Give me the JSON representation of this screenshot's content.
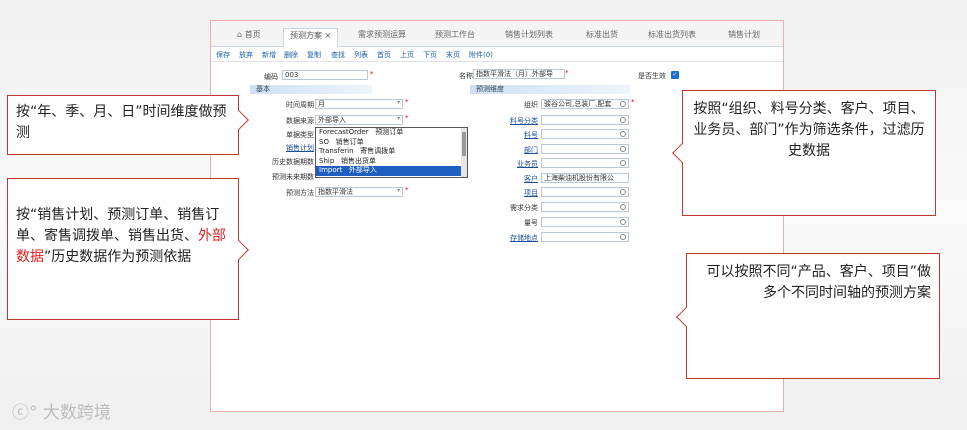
{
  "tabs": [
    "首页",
    "预测方案",
    "需求预测运算",
    "预测工作台",
    "销售计划列表",
    "标准出货",
    "标准出货列表",
    "销售计划"
  ],
  "toolbar": [
    "保存",
    "放弃",
    "新增",
    "删除",
    "复制",
    "查找",
    "列表",
    "首页",
    "上页",
    "下页",
    "末页",
    "附件(0)"
  ],
  "form": {
    "code_label": "编码",
    "code_value": "003",
    "name_label": "名称",
    "name_value": "指数平滑法（月）外部导",
    "effective_label": "是否生效",
    "basic_section": "基本",
    "dimension_section": "预测维度",
    "period_label": "时间周期",
    "period_value": "月",
    "source_label": "数据来源",
    "source_value": "外部导入",
    "doc_type_label": "单据类型",
    "sales_plan_label": "销售计划",
    "history_label": "历史数据期数",
    "future_label": "预测未来期数",
    "method_label": "预测方法",
    "method_value": "指数平滑法",
    "org_label": "组织",
    "org_value": "骏谷公司,总装厂,配套",
    "item_cat_label": "料号分类",
    "item_label": "料号",
    "dept_label": "部门",
    "sales_label": "业务员",
    "customer_label": "客户",
    "customer_value": "上海柴油机股份有限公",
    "project_label": "项目",
    "demand_label": "需求分类",
    "qty_label": "量号",
    "storage_label": "存储地点"
  },
  "dropdown": [
    {
      "code": "ForecastOrder",
      "name": "预测订单"
    },
    {
      "code": "SO",
      "name": "销售订单"
    },
    {
      "code": "Transferin",
      "name": "寄售调拨单"
    },
    {
      "code": "Ship",
      "name": "销售出货单"
    },
    {
      "code": "Import",
      "name": "外部导入"
    }
  ],
  "callouts": {
    "c1": "按“年、季、月、日”时间维度做预测",
    "c2a": "按“销售计划、预测订单、销售订单、寄售调拨单、销售出货、",
    "c2red": "外部数据",
    "c2b": "”历史数据作为预测依据",
    "c3": "按照“组织、料号分类、客户、项目、业务员、部门”作为筛选条件，过滤历史数据",
    "c4": "可以按照不同“产品、客户、项目”做多个不同时间轴的预测方案"
  },
  "watermark": "大数跨境"
}
